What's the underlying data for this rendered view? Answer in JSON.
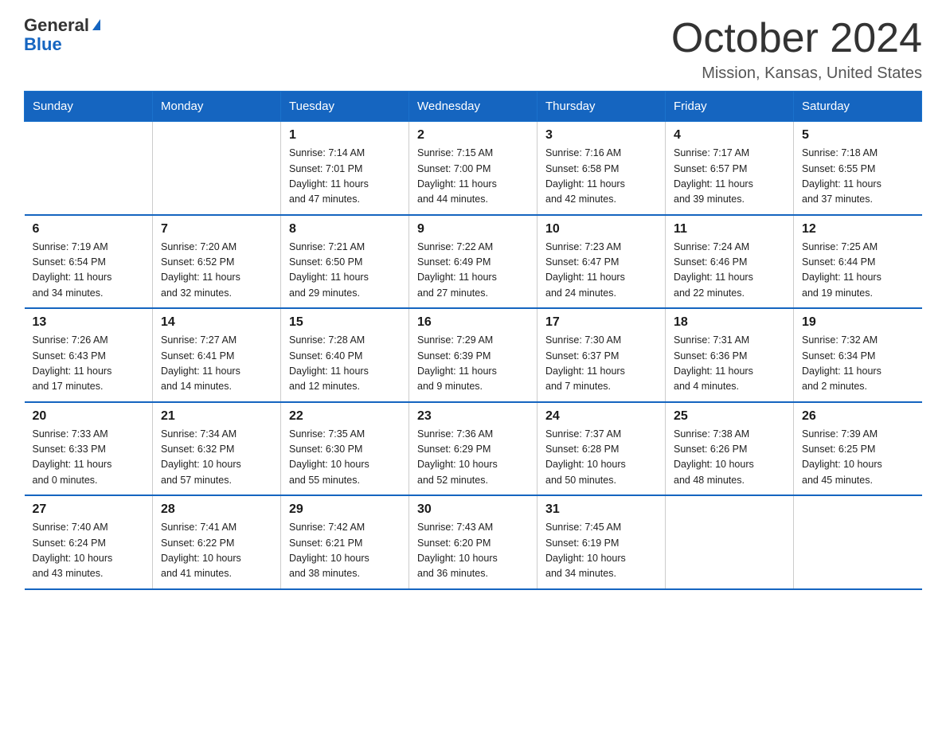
{
  "header": {
    "logo_general": "General",
    "logo_blue": "Blue",
    "month_title": "October 2024",
    "location": "Mission, Kansas, United States"
  },
  "days_of_week": [
    "Sunday",
    "Monday",
    "Tuesday",
    "Wednesday",
    "Thursday",
    "Friday",
    "Saturday"
  ],
  "weeks": [
    [
      {
        "day": "",
        "info": ""
      },
      {
        "day": "",
        "info": ""
      },
      {
        "day": "1",
        "info": "Sunrise: 7:14 AM\nSunset: 7:01 PM\nDaylight: 11 hours\nand 47 minutes."
      },
      {
        "day": "2",
        "info": "Sunrise: 7:15 AM\nSunset: 7:00 PM\nDaylight: 11 hours\nand 44 minutes."
      },
      {
        "day": "3",
        "info": "Sunrise: 7:16 AM\nSunset: 6:58 PM\nDaylight: 11 hours\nand 42 minutes."
      },
      {
        "day": "4",
        "info": "Sunrise: 7:17 AM\nSunset: 6:57 PM\nDaylight: 11 hours\nand 39 minutes."
      },
      {
        "day": "5",
        "info": "Sunrise: 7:18 AM\nSunset: 6:55 PM\nDaylight: 11 hours\nand 37 minutes."
      }
    ],
    [
      {
        "day": "6",
        "info": "Sunrise: 7:19 AM\nSunset: 6:54 PM\nDaylight: 11 hours\nand 34 minutes."
      },
      {
        "day": "7",
        "info": "Sunrise: 7:20 AM\nSunset: 6:52 PM\nDaylight: 11 hours\nand 32 minutes."
      },
      {
        "day": "8",
        "info": "Sunrise: 7:21 AM\nSunset: 6:50 PM\nDaylight: 11 hours\nand 29 minutes."
      },
      {
        "day": "9",
        "info": "Sunrise: 7:22 AM\nSunset: 6:49 PM\nDaylight: 11 hours\nand 27 minutes."
      },
      {
        "day": "10",
        "info": "Sunrise: 7:23 AM\nSunset: 6:47 PM\nDaylight: 11 hours\nand 24 minutes."
      },
      {
        "day": "11",
        "info": "Sunrise: 7:24 AM\nSunset: 6:46 PM\nDaylight: 11 hours\nand 22 minutes."
      },
      {
        "day": "12",
        "info": "Sunrise: 7:25 AM\nSunset: 6:44 PM\nDaylight: 11 hours\nand 19 minutes."
      }
    ],
    [
      {
        "day": "13",
        "info": "Sunrise: 7:26 AM\nSunset: 6:43 PM\nDaylight: 11 hours\nand 17 minutes."
      },
      {
        "day": "14",
        "info": "Sunrise: 7:27 AM\nSunset: 6:41 PM\nDaylight: 11 hours\nand 14 minutes."
      },
      {
        "day": "15",
        "info": "Sunrise: 7:28 AM\nSunset: 6:40 PM\nDaylight: 11 hours\nand 12 minutes."
      },
      {
        "day": "16",
        "info": "Sunrise: 7:29 AM\nSunset: 6:39 PM\nDaylight: 11 hours\nand 9 minutes."
      },
      {
        "day": "17",
        "info": "Sunrise: 7:30 AM\nSunset: 6:37 PM\nDaylight: 11 hours\nand 7 minutes."
      },
      {
        "day": "18",
        "info": "Sunrise: 7:31 AM\nSunset: 6:36 PM\nDaylight: 11 hours\nand 4 minutes."
      },
      {
        "day": "19",
        "info": "Sunrise: 7:32 AM\nSunset: 6:34 PM\nDaylight: 11 hours\nand 2 minutes."
      }
    ],
    [
      {
        "day": "20",
        "info": "Sunrise: 7:33 AM\nSunset: 6:33 PM\nDaylight: 11 hours\nand 0 minutes."
      },
      {
        "day": "21",
        "info": "Sunrise: 7:34 AM\nSunset: 6:32 PM\nDaylight: 10 hours\nand 57 minutes."
      },
      {
        "day": "22",
        "info": "Sunrise: 7:35 AM\nSunset: 6:30 PM\nDaylight: 10 hours\nand 55 minutes."
      },
      {
        "day": "23",
        "info": "Sunrise: 7:36 AM\nSunset: 6:29 PM\nDaylight: 10 hours\nand 52 minutes."
      },
      {
        "day": "24",
        "info": "Sunrise: 7:37 AM\nSunset: 6:28 PM\nDaylight: 10 hours\nand 50 minutes."
      },
      {
        "day": "25",
        "info": "Sunrise: 7:38 AM\nSunset: 6:26 PM\nDaylight: 10 hours\nand 48 minutes."
      },
      {
        "day": "26",
        "info": "Sunrise: 7:39 AM\nSunset: 6:25 PM\nDaylight: 10 hours\nand 45 minutes."
      }
    ],
    [
      {
        "day": "27",
        "info": "Sunrise: 7:40 AM\nSunset: 6:24 PM\nDaylight: 10 hours\nand 43 minutes."
      },
      {
        "day": "28",
        "info": "Sunrise: 7:41 AM\nSunset: 6:22 PM\nDaylight: 10 hours\nand 41 minutes."
      },
      {
        "day": "29",
        "info": "Sunrise: 7:42 AM\nSunset: 6:21 PM\nDaylight: 10 hours\nand 38 minutes."
      },
      {
        "day": "30",
        "info": "Sunrise: 7:43 AM\nSunset: 6:20 PM\nDaylight: 10 hours\nand 36 minutes."
      },
      {
        "day": "31",
        "info": "Sunrise: 7:45 AM\nSunset: 6:19 PM\nDaylight: 10 hours\nand 34 minutes."
      },
      {
        "day": "",
        "info": ""
      },
      {
        "day": "",
        "info": ""
      }
    ]
  ]
}
